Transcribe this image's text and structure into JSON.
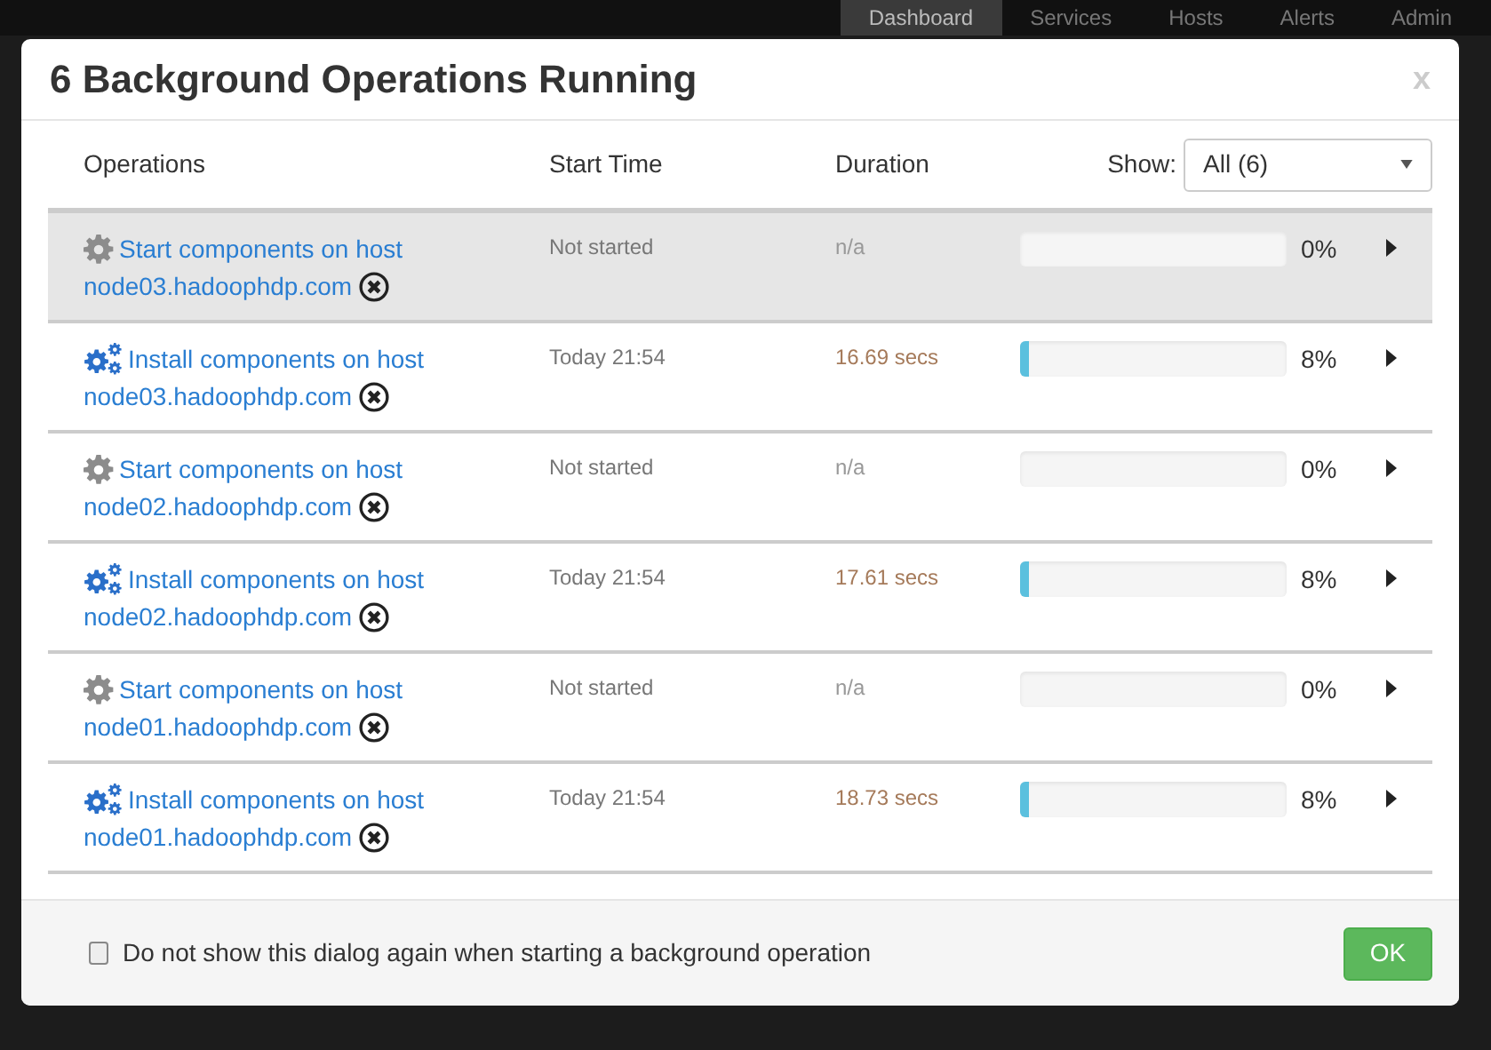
{
  "background": {
    "nav_tabs": [
      {
        "label": "Dashboard",
        "selected": true
      },
      {
        "label": "Services",
        "selected": false
      },
      {
        "label": "Hosts",
        "selected": false
      },
      {
        "label": "Alerts",
        "selected": false
      },
      {
        "label": "Admin",
        "selected": false
      }
    ]
  },
  "dialog": {
    "title": "6 Background Operations Running",
    "close": "x",
    "columns": [
      "Operations",
      "Start Time",
      "Duration"
    ],
    "filter": {
      "label": "Show:",
      "value": "All (6)"
    },
    "operations": [
      {
        "kind": "pending",
        "name": "Start components on host",
        "host": "node03.hadoophdp.com",
        "start_time": "Not started",
        "duration": "n/a",
        "percent": "0%",
        "selected": true
      },
      {
        "kind": "running",
        "name": "Install components on host",
        "host": "node03.hadoophdp.com",
        "start_time": "Today 21:54",
        "duration": "16.69 secs",
        "level": 0.03,
        "percent": "8%",
        "selected": false
      },
      {
        "kind": "pending",
        "name": "Start components on host",
        "host": "node02.hadoophdp.com",
        "start_time": "Not started",
        "duration": "n/a",
        "percent": "0%",
        "selected": false
      },
      {
        "kind": "running",
        "name": "Install components on host",
        "host": "node02.hadoophdp.com",
        "start_time": "Today 21:54",
        "duration": "17.61 secs",
        "level": 0.03,
        "percent": "8%",
        "selected": false
      },
      {
        "kind": "pending",
        "name": "Start components on host",
        "host": "node01.hadoophdp.com",
        "start_time": "Not started",
        "duration": "n/a",
        "percent": "0%",
        "selected": false
      },
      {
        "kind": "running",
        "name": "Install components on host",
        "host": "node01.hadoophdp.com",
        "start_time": "Today 21:54",
        "duration": "18.73 secs",
        "level": 0.03,
        "percent": "8%",
        "selected": false
      }
    ],
    "dont_show_again": {
      "label": "Do not show this dialog again when starting a background operation",
      "checked": false
    },
    "ok_button": "OK"
  }
}
